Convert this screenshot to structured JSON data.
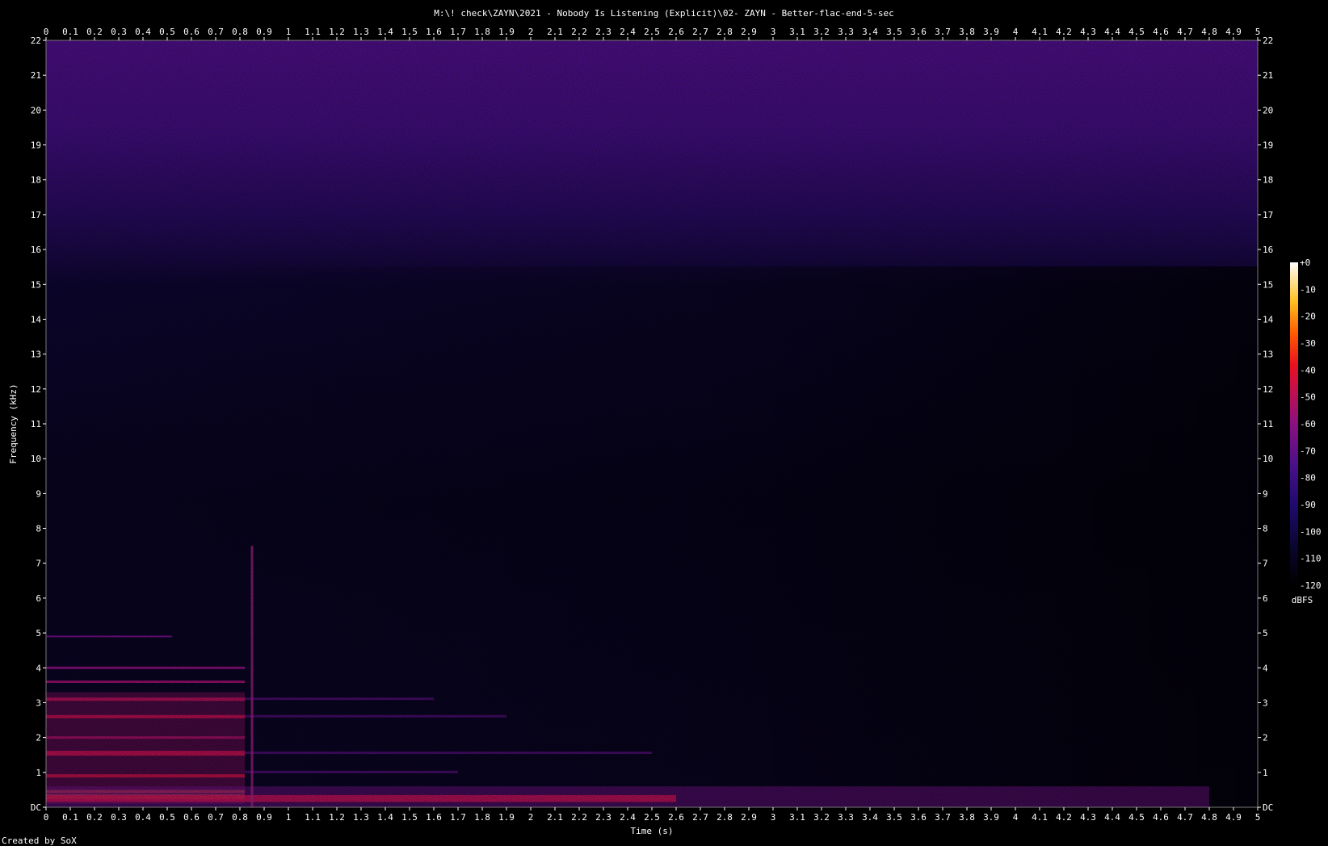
{
  "chart_data": {
    "type": "heatmap",
    "title": "M:\\! check\\ZAYN\\2021 - Nobody Is Listening (Explicit)\\02- ZAYN - Better-flac-end-5-sec",
    "xlabel": "Time (s)",
    "ylabel": "Frequency (kHz)",
    "xlim": [
      0,
      5
    ],
    "ylim": [
      0,
      22
    ],
    "x_ticks": [
      "0",
      "0.1",
      "0.2",
      "0.3",
      "0.4",
      "0.5",
      "0.6",
      "0.7",
      "0.8",
      "0.9",
      "1",
      "1.1",
      "1.2",
      "1.3",
      "1.4",
      "1.5",
      "1.6",
      "1.7",
      "1.8",
      "1.9",
      "2",
      "2.1",
      "2.2",
      "2.3",
      "2.4",
      "2.5",
      "2.6",
      "2.7",
      "2.8",
      "2.9",
      "3",
      "3.1",
      "3.2",
      "3.3",
      "3.4",
      "3.5",
      "3.6",
      "3.7",
      "3.8",
      "3.9",
      "4",
      "4.1",
      "4.2",
      "4.3",
      "4.4",
      "4.5",
      "4.6",
      "4.7",
      "4.8",
      "4.9",
      "5"
    ],
    "y_ticks": [
      "DC",
      "1",
      "2",
      "3",
      "4",
      "5",
      "6",
      "7",
      "8",
      "9",
      "10",
      "11",
      "12",
      "13",
      "14",
      "15",
      "16",
      "17",
      "18",
      "19",
      "20",
      "21",
      "22"
    ],
    "colorbar": {
      "label": "dBFS",
      "ticks": [
        "+0",
        "-10",
        "-20",
        "-30",
        "-40",
        "-50",
        "-60",
        "-70",
        "-80",
        "-90",
        "-100",
        "-110",
        "-120"
      ],
      "range": [
        -120,
        0
      ]
    },
    "grid": false,
    "features": [
      {
        "name": "high-band noise floor",
        "freq_khz": [
          16,
          22
        ],
        "time_s": [
          0,
          5
        ],
        "level_dbfs": -85
      },
      {
        "name": "low harmonics",
        "freq_khz": [
          0,
          5
        ],
        "time_s": [
          0,
          0.82
        ],
        "level_dbfs": -45
      },
      {
        "name": "transient",
        "freq_khz": [
          0,
          7.5
        ],
        "time_s": [
          0.85,
          0.85
        ],
        "level_dbfs": -80
      },
      {
        "name": "sub-bass decay",
        "freq_khz": [
          0,
          0.6
        ],
        "time_s": [
          0,
          4.8
        ],
        "level_dbfs": -60
      }
    ]
  },
  "footer": {
    "credit": "Created by SoX"
  }
}
